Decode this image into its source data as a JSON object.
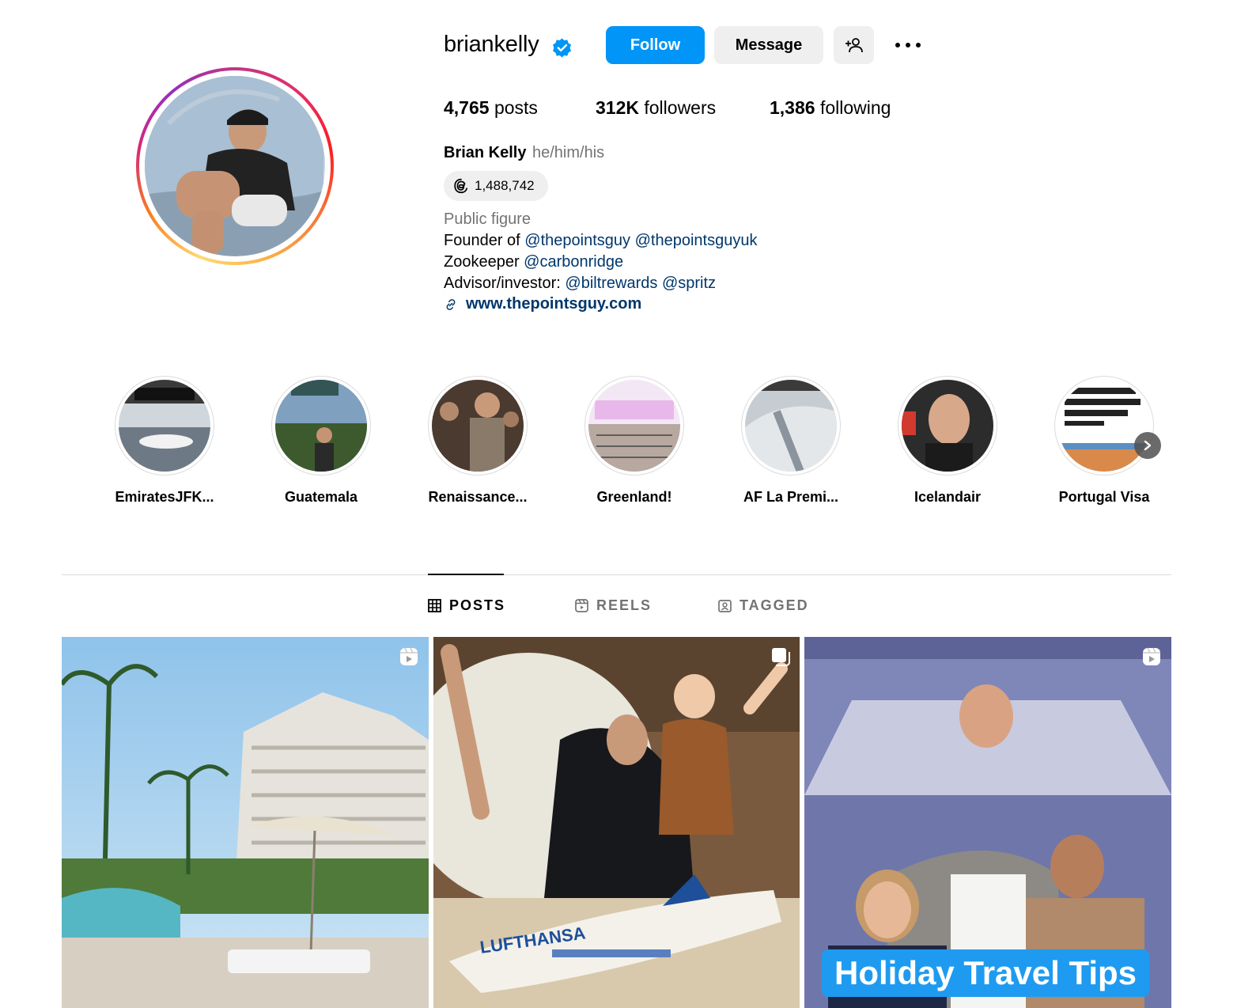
{
  "profile": {
    "username": "briankelly",
    "follow_label": "Follow",
    "message_label": "Message",
    "stats": {
      "posts_count": "4,765",
      "posts_label": "posts",
      "followers_count": "312K",
      "followers_label": "followers",
      "following_count": "1,386",
      "following_label": "following"
    },
    "full_name": "Brian Kelly",
    "pronouns": "he/him/his",
    "threads_count": "1,488,742",
    "category": "Public figure",
    "bio": {
      "line1_prefix": "Founder of ",
      "line1_mention1": "@thepointsguy",
      "line1_mention2": "@thepointsguyuk",
      "line2_prefix": "Zookeeper ",
      "line2_mention": "@carbonridge",
      "line3_prefix": "Advisor/investor: ",
      "line3_mention1": "@biltrewards",
      "line3_mention2": "@spritz"
    },
    "website": "www.thepointsguy.com"
  },
  "highlights": [
    {
      "label": "EmiratesJFK..."
    },
    {
      "label": "Guatemala"
    },
    {
      "label": "Renaissance..."
    },
    {
      "label": "Greenland!"
    },
    {
      "label": "AF La Premi..."
    },
    {
      "label": "Icelandair"
    },
    {
      "label": "Portugal Visa"
    }
  ],
  "tabs": {
    "posts": "POSTS",
    "reels": "REELS",
    "tagged": "TAGGED"
  },
  "posts": [
    {
      "type_icon": "reel-icon"
    },
    {
      "type_icon": "carousel-icon"
    },
    {
      "type_icon": "reel-icon",
      "caption": "Holiday Travel Tips"
    }
  ],
  "colors": {
    "accent": "#0095f6",
    "link": "#00376b",
    "secondary_text": "#737373"
  }
}
